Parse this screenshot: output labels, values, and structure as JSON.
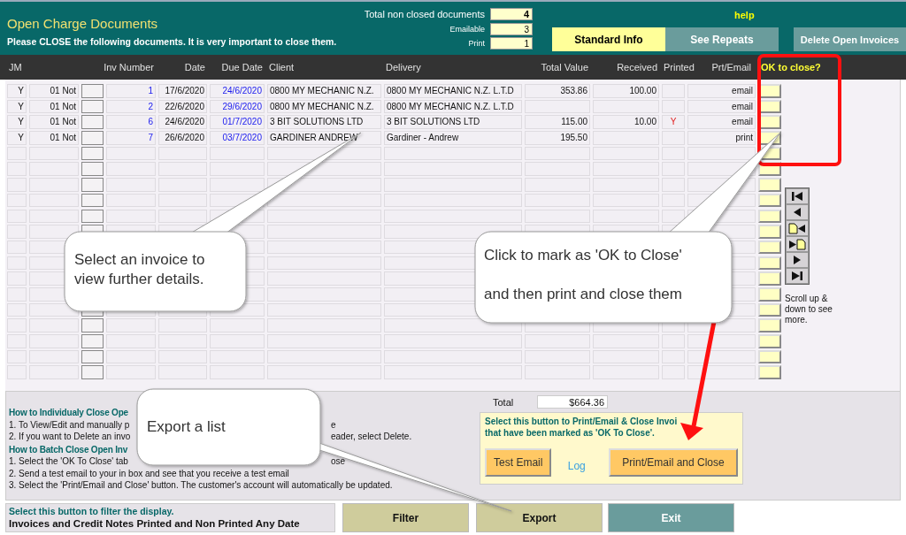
{
  "header": {
    "title": "Open Charge Documents",
    "subtitle": "Please CLOSE the following documents. It is very important to close them.",
    "help": "help",
    "totals": [
      {
        "label": "Total non closed documents",
        "value": "4"
      },
      {
        "label": "Emailable",
        "value": "3"
      },
      {
        "label": "Print",
        "value": "1"
      }
    ]
  },
  "tabs": [
    {
      "label": "Standard Info",
      "selected": true
    },
    {
      "label": "See Repeats",
      "selected": false
    }
  ],
  "delete_button": "Delete Open Invoices",
  "table": {
    "columns": [
      "JM",
      "Inv Number",
      "Date",
      "Due Date",
      "Client",
      "Delivery",
      "Total Value",
      "Received",
      "Printed",
      "Prt/Email",
      "OK to close?"
    ],
    "rows": [
      {
        "jm": "Y",
        "status": "01 Not",
        "inv": "1",
        "date": "17/6/2020",
        "due": "24/6/2020",
        "client": "0800 MY MECHANIC N.Z.",
        "delivery": "0800 MY MECHANIC N.Z. L.T.D",
        "total": "353.86",
        "received": "100.00",
        "printed": "",
        "prt_email": "email"
      },
      {
        "jm": "Y",
        "status": "01 Not",
        "inv": "2",
        "date": "22/6/2020",
        "due": "29/6/2020",
        "client": "0800 MY MECHANIC N.Z.",
        "delivery": "0800 MY MECHANIC N.Z. L.T.D",
        "total": "",
        "received": "",
        "printed": "",
        "prt_email": "email"
      },
      {
        "jm": "Y",
        "status": "01 Not",
        "inv": "6",
        "date": "24/6/2020",
        "due": "01/7/2020",
        "client": "3 BIT SOLUTIONS LTD",
        "delivery": "3 BIT SOLUTIONS LTD",
        "total": "115.00",
        "received": "10.00",
        "printed": "Y",
        "prt_email": "email"
      },
      {
        "jm": "Y",
        "status": "01 Not",
        "inv": "7",
        "date": "26/6/2020",
        "due": "03/7/2020",
        "client": "GARDINER ANDREW",
        "delivery": "Gardiner -  Andrew",
        "total": "195.50",
        "received": "",
        "printed": "",
        "prt_email": "print"
      }
    ]
  },
  "scroll_note": "Scroll up & down to see more.",
  "help": [
    {
      "kind": "heading",
      "text": "How to Individualy Close Ope"
    },
    {
      "kind": "line",
      "text": "1. To View/Edit and manually p",
      "rest": "e"
    },
    {
      "kind": "line",
      "text": "2. If you want to Delete an invo",
      "rest": "eader, select Delete."
    },
    {
      "kind": "heading",
      "text": "How to Batch Close Open Inv"
    },
    {
      "kind": "line",
      "text": "1. Select the 'OK To Close' tab",
      "rest": "ose"
    },
    {
      "kind": "line",
      "text": "2. Send a test email to your  in box and see that you receive a test email"
    },
    {
      "kind": "line",
      "text": "3. Select the 'Print/Email and Close' button. The customer's account will automatically be updated."
    }
  ],
  "total": {
    "label": "Total",
    "value": "$664.36"
  },
  "print_panel": {
    "note_lines": [
      "Select this button to Print/Email & Close Invoi",
      "that have been marked as 'OK To Close'."
    ],
    "test_button": "Test Email",
    "log_link": "Log",
    "print_button": "Print/Email and Close"
  },
  "filter": {
    "hint": "Select this button to filter the display.",
    "description": "Invoices and Credit Notes Printed and Non Printed Any Date",
    "button": "Filter"
  },
  "export_button": "Export",
  "exit_button": "Exit",
  "callouts": [
    {
      "lines": [
        "Select an invoice to view further details."
      ]
    },
    {
      "lines": [
        "Click to mark as 'OK to Close'",
        "and then print and close them"
      ]
    },
    {
      "lines": [
        "Export a list"
      ]
    }
  ]
}
